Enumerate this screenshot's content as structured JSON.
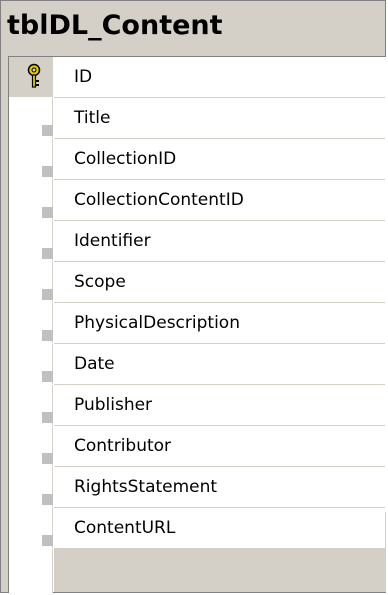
{
  "table": {
    "name": "tblDL_Content",
    "columns": [
      {
        "name": "ID",
        "primary_key": true
      },
      {
        "name": "Title",
        "primary_key": false
      },
      {
        "name": "CollectionID",
        "primary_key": false
      },
      {
        "name": "CollectionContentID",
        "primary_key": false
      },
      {
        "name": "Identifier",
        "primary_key": false
      },
      {
        "name": "Scope",
        "primary_key": false
      },
      {
        "name": "PhysicalDescription",
        "primary_key": false
      },
      {
        "name": "Date",
        "primary_key": false
      },
      {
        "name": "Publisher",
        "primary_key": false
      },
      {
        "name": "Contributor",
        "primary_key": false
      },
      {
        "name": "RightsStatement",
        "primary_key": false
      },
      {
        "name": "ContentURL",
        "primary_key": false
      }
    ]
  },
  "icons": {
    "primary_key": "key-icon"
  },
  "colors": {
    "window_background": "#d4d0c8",
    "key_icon": "#e6c800"
  }
}
